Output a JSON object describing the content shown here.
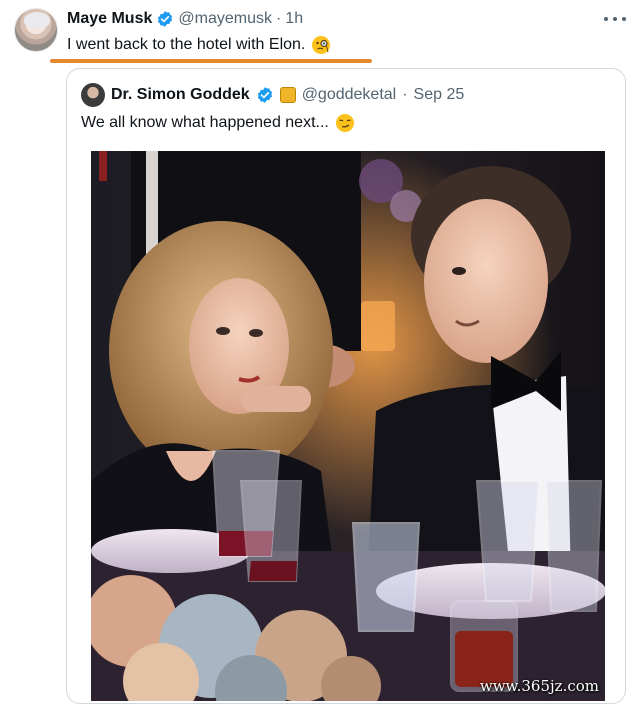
{
  "tweet": {
    "author_name": "Maye Musk",
    "author_handle": "@mayemusk",
    "separator": "·",
    "time": "1h",
    "text": "I went back to the hotel with Elon.",
    "emoji": "face-with-monocle",
    "more_icon": "more-horizontal-icon"
  },
  "quoted_tweet": {
    "author_name": "Dr. Simon Goddek",
    "author_handle": "@goddeketal",
    "separator": "·",
    "date": "Sep 25",
    "text": "We all know what happened next...",
    "emoji": "smirking-face"
  },
  "colors": {
    "verified": "#1d9bf0",
    "highlight_underline": "#e5892f",
    "muted_text": "#536471",
    "border": "#cfd9de"
  },
  "watermark": "www.365jz.com"
}
